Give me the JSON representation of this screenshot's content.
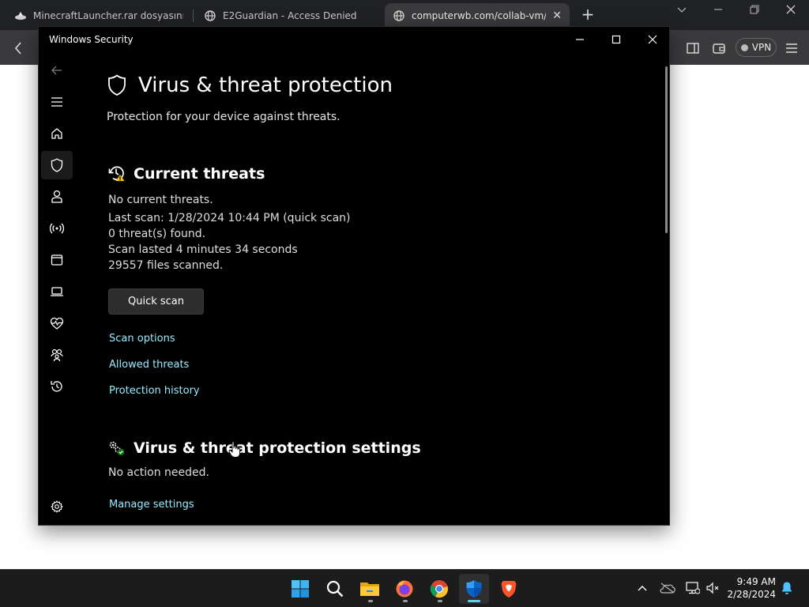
{
  "browser": {
    "tabs": [
      {
        "title": "MinecraftLauncher.rar dosyasını indi",
        "active": false
      },
      {
        "title": "E2Guardian - Access Denied",
        "active": false
      },
      {
        "title": "computerwb.com/collab-vm/cla",
        "active": true
      }
    ],
    "vpn_label": "VPN"
  },
  "window": {
    "title": "Windows Security"
  },
  "nav": {
    "items": [
      "back-arrow",
      "menu",
      "home",
      "virus-protection",
      "account-protection",
      "firewall-network",
      "app-browser-control",
      "device-security",
      "device-performance",
      "family-options",
      "protection-history",
      "settings"
    ],
    "selected": "virus-protection"
  },
  "page": {
    "title": "Virus & threat protection",
    "subtitle": "Protection for your device against threats."
  },
  "threats": {
    "heading": "Current threats",
    "status": "No current threats.",
    "last_scan": "Last scan: 1/28/2024 10:44 PM (quick scan)",
    "found": "0 threat(s) found.",
    "duration": "Scan lasted 4 minutes 34 seconds",
    "files": "29557 files scanned.",
    "quick_scan_label": "Quick scan",
    "links": [
      "Scan options",
      "Allowed threats",
      "Protection history"
    ]
  },
  "settings": {
    "heading": "Virus & threat protection settings",
    "status": "No action needed.",
    "manage_link": "Manage settings"
  },
  "taskbar": {
    "apps": [
      "start",
      "search",
      "file-explorer",
      "firefox",
      "chrome",
      "windows-security",
      "brave"
    ],
    "active_app": "windows-security",
    "time": "9:49 AM",
    "date": "2/28/2024"
  },
  "colors": {
    "accent": "#60cdff",
    "link": "#99ebff",
    "window_bg": "#000000"
  }
}
